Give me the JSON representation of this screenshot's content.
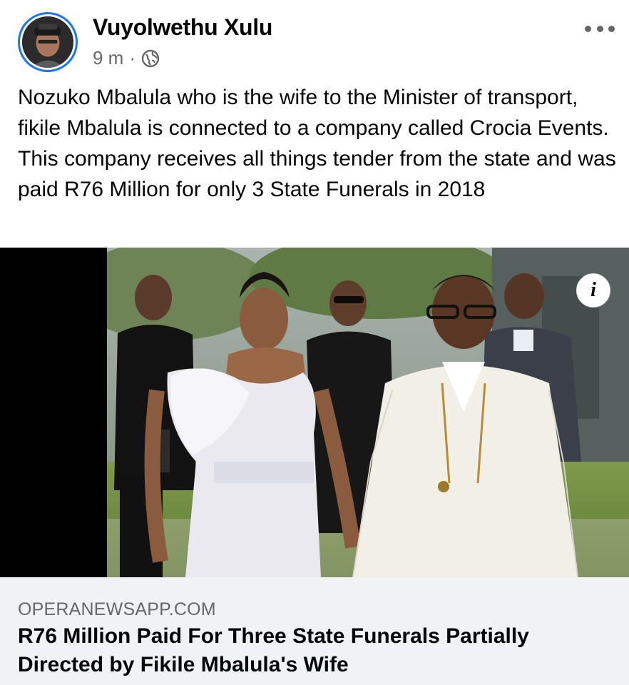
{
  "post": {
    "author": "Vuyolwethu Xulu",
    "time": "9 m",
    "separator": "·",
    "privacy_icon": "globe-icon",
    "more_icon": "more-options-icon",
    "text": "Nozuko Mbalula who is the wife to the Minister of transport, fikile Mbalula is connected to a company called Crocia Events. This company receives all things tender from the state and was paid R76 Million for only 3 State Funerals in 2018"
  },
  "link": {
    "info_label": "i",
    "domain": "OPERANEWSAPP.COM",
    "headline": "R76 Million Paid For Three State Funerals Partially Directed by Fikile Mbalula's Wife"
  },
  "colors": {
    "accent": "#1877f2",
    "secondary_text": "#65676b",
    "preview_bg": "#f0f2f5"
  }
}
